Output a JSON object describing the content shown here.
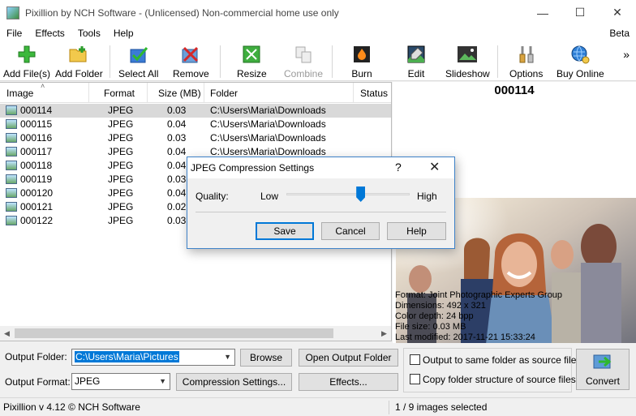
{
  "window": {
    "title": "Pixillion by NCH Software - (Unlicensed) Non-commercial home use only",
    "minimize": "—",
    "maximize": "☐",
    "close": "✕"
  },
  "menu": {
    "items": [
      "File",
      "Effects",
      "Tools",
      "Help"
    ],
    "beta": "Beta"
  },
  "toolbar": {
    "buttons": [
      {
        "label": "Add File(s)",
        "icon": "add-file-icon"
      },
      {
        "label": "Add Folder",
        "icon": "add-folder-icon"
      },
      {
        "label": "Select All",
        "icon": "select-all-icon"
      },
      {
        "label": "Remove",
        "icon": "remove-icon"
      },
      {
        "label": "Resize",
        "icon": "resize-icon"
      },
      {
        "label": "Combine",
        "icon": "combine-icon",
        "disabled": true
      },
      {
        "label": "Burn",
        "icon": "burn-icon"
      },
      {
        "label": "Edit",
        "icon": "edit-icon"
      },
      {
        "label": "Slideshow",
        "icon": "slideshow-icon"
      },
      {
        "label": "Options",
        "icon": "options-icon"
      },
      {
        "label": "Buy Online",
        "icon": "buy-online-icon"
      }
    ],
    "more": "»"
  },
  "file_list": {
    "columns": [
      "Image",
      "Format",
      "Size (MB)",
      "Folder",
      "Status"
    ],
    "sort_indicator": "˄",
    "rows": [
      {
        "image": "000114",
        "format": "JPEG",
        "size": "0.03",
        "folder": "C:\\Users\\Maria\\Downloads",
        "selected": true
      },
      {
        "image": "000115",
        "format": "JPEG",
        "size": "0.04",
        "folder": "C:\\Users\\Maria\\Downloads"
      },
      {
        "image": "000116",
        "format": "JPEG",
        "size": "0.03",
        "folder": "C:\\Users\\Maria\\Downloads"
      },
      {
        "image": "000117",
        "format": "JPEG",
        "size": "0.04",
        "folder": "C:\\Users\\Maria\\Downloads"
      },
      {
        "image": "000118",
        "format": "JPEG",
        "size": "0.04",
        "folder": "C:\\Users\\Maria\\Downloads"
      },
      {
        "image": "000119",
        "format": "JPEG",
        "size": "0.03",
        "folder": "C:\\Users\\Maria\\Downloads"
      },
      {
        "image": "000120",
        "format": "JPEG",
        "size": "0.04",
        "folder": "C:\\Users\\Maria\\Downloads"
      },
      {
        "image": "000121",
        "format": "JPEG",
        "size": "0.02",
        "folder": "C:\\Users\\Maria\\Downloads"
      },
      {
        "image": "000122",
        "format": "JPEG",
        "size": "0.03",
        "folder": "C:\\Users\\Maria\\Downloads"
      }
    ]
  },
  "preview": {
    "title": "000114",
    "info": [
      "Format: Joint Photographic Experts Group",
      "Dimensions: 492 x 321",
      "Color depth: 24 bpp",
      "File size: 0.03 MB",
      "Last modified:  2017-11-21 15:33:24"
    ]
  },
  "output": {
    "folder_label": "Output Folder:",
    "folder_value": "C:\\Users\\Maria\\Pictures",
    "browse": "Browse",
    "open_folder": "Open Output Folder",
    "format_label": "Output Format:",
    "format_value": "JPEG",
    "compression": "Compression Settings...",
    "effects": "Effects...",
    "same_folder": "Output to same folder as source files",
    "copy_structure": "Copy folder structure of source files",
    "convert": "Convert"
  },
  "status": {
    "version": "Pixillion v 4.12 © NCH Software",
    "selection": "1 / 9 images selected"
  },
  "dialog": {
    "title": "JPEG Compression Settings",
    "help": "?",
    "close": "✕",
    "quality_label": "Quality:",
    "low": "Low",
    "high": "High",
    "quality_level": 0.6,
    "save": "Save",
    "cancel": "Cancel",
    "help_button": "Help"
  },
  "colors": {
    "accent": "#0078d7",
    "selected_row": "#d9d9d9"
  }
}
